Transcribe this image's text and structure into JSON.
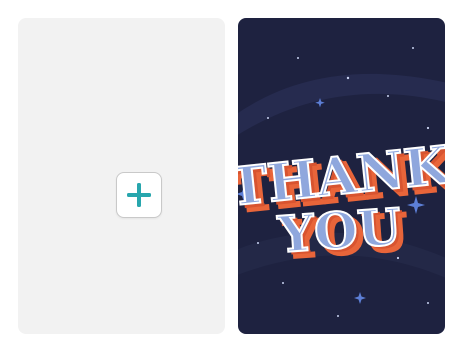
{
  "left_card": {
    "add_icon": "plus-icon",
    "accent_color": "#27a6ad",
    "background_color": "#f2f2f2"
  },
  "right_card": {
    "background_color": "#1e2240",
    "artwork": {
      "line1": "THANK",
      "line2": "YOU",
      "face_color": "#8fa7dd",
      "shadow_color": "#e8653a",
      "outline_color": "#ffffff"
    }
  }
}
